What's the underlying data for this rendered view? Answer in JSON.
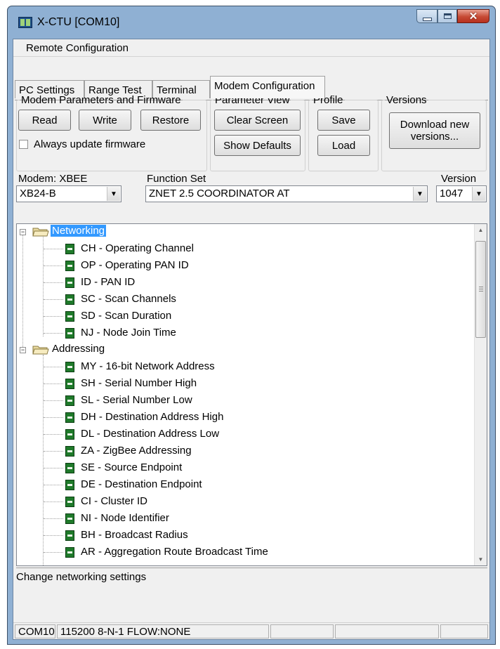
{
  "window": {
    "title": "X-CTU  [COM10]",
    "title_bar_color": "#8fb0d3",
    "close_color": "#c64a34"
  },
  "menu": {
    "remote_configuration": "Remote Configuration"
  },
  "tabs": [
    {
      "label": "PC Settings"
    },
    {
      "label": "Range Test"
    },
    {
      "label": "Terminal"
    },
    {
      "label": "Modem Configuration",
      "active": true
    }
  ],
  "groups": {
    "modem_params": {
      "legend": "Modem Parameters and Firmware",
      "read": "Read",
      "write": "Write",
      "restore": "Restore",
      "always_update": "Always update firmware",
      "always_update_checked": false
    },
    "parameter_view": {
      "legend": "Parameter View",
      "clear_screen": "Clear Screen",
      "show_defaults": "Show Defaults"
    },
    "profile": {
      "legend": "Profile",
      "save": "Save",
      "load": "Load"
    },
    "versions": {
      "legend": "Versions",
      "download_line1": "Download new",
      "download_line2": "versions..."
    }
  },
  "selectors": {
    "modem_label": "Modem: XBEE",
    "modem_value": "XB24-B",
    "function_set_label": "Function Set",
    "function_set_value": "ZNET 2.5 COORDINATOR AT",
    "version_label": "Version",
    "version_value": "1047"
  },
  "tree": {
    "networking": {
      "label": "Networking",
      "selected": true,
      "items": [
        "CH - Operating Channel",
        "OP - Operating PAN ID",
        "ID - PAN ID",
        "SC - Scan Channels",
        "SD - Scan Duration",
        "NJ - Node Join Time"
      ]
    },
    "addressing": {
      "label": "Addressing",
      "items": [
        "MY - 16-bit Network Address",
        "SH - Serial Number High",
        "SL - Serial Number Low",
        "DH - Destination Address High",
        "DL - Destination Address Low",
        "ZA - ZigBee Addressing",
        "SE - Source Endpoint",
        "DE - Destination Endpoint",
        "CI - Cluster ID",
        "NI - Node Identifier",
        "BH - Broadcast Radius",
        "AR - Aggregation Route Broadcast Time"
      ]
    },
    "icons": {
      "folder": "folder-icon",
      "parameter": "parameter-icon"
    },
    "selection_color": "#3399ff",
    "parameter_icon_color": "#1f7a2a"
  },
  "description": "Change networking settings",
  "status": {
    "port": "COM10",
    "settings": "115200 8-N-1  FLOW:NONE"
  }
}
